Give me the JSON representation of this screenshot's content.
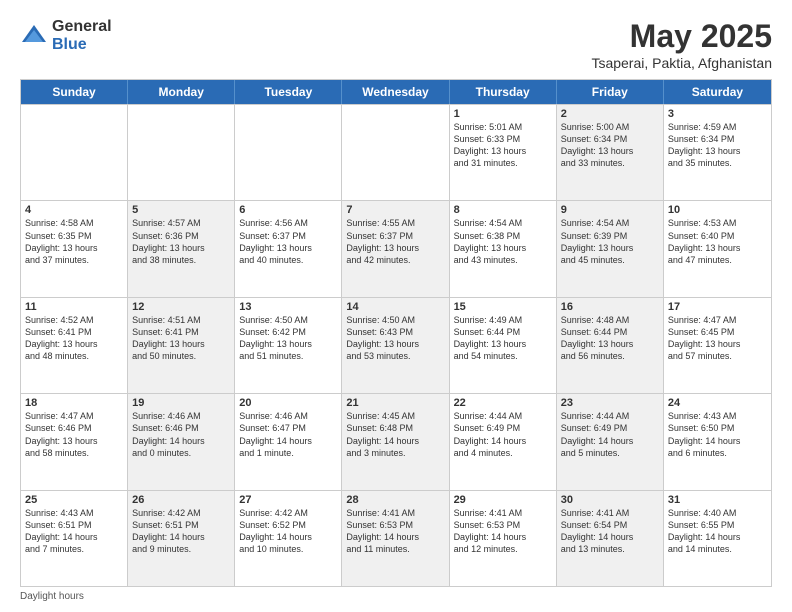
{
  "logo": {
    "general": "General",
    "blue": "Blue"
  },
  "title": "May 2025",
  "subtitle": "Tsaperai, Paktia, Afghanistan",
  "days": [
    "Sunday",
    "Monday",
    "Tuesday",
    "Wednesday",
    "Thursday",
    "Friday",
    "Saturday"
  ],
  "weeks": [
    [
      {
        "day": "",
        "text": "",
        "shaded": false
      },
      {
        "day": "",
        "text": "",
        "shaded": false
      },
      {
        "day": "",
        "text": "",
        "shaded": false
      },
      {
        "day": "",
        "text": "",
        "shaded": false
      },
      {
        "day": "1",
        "text": "Sunrise: 5:01 AM\nSunset: 6:33 PM\nDaylight: 13 hours\nand 31 minutes.",
        "shaded": false
      },
      {
        "day": "2",
        "text": "Sunrise: 5:00 AM\nSunset: 6:34 PM\nDaylight: 13 hours\nand 33 minutes.",
        "shaded": true
      },
      {
        "day": "3",
        "text": "Sunrise: 4:59 AM\nSunset: 6:34 PM\nDaylight: 13 hours\nand 35 minutes.",
        "shaded": false
      }
    ],
    [
      {
        "day": "4",
        "text": "Sunrise: 4:58 AM\nSunset: 6:35 PM\nDaylight: 13 hours\nand 37 minutes.",
        "shaded": false
      },
      {
        "day": "5",
        "text": "Sunrise: 4:57 AM\nSunset: 6:36 PM\nDaylight: 13 hours\nand 38 minutes.",
        "shaded": true
      },
      {
        "day": "6",
        "text": "Sunrise: 4:56 AM\nSunset: 6:37 PM\nDaylight: 13 hours\nand 40 minutes.",
        "shaded": false
      },
      {
        "day": "7",
        "text": "Sunrise: 4:55 AM\nSunset: 6:37 PM\nDaylight: 13 hours\nand 42 minutes.",
        "shaded": true
      },
      {
        "day": "8",
        "text": "Sunrise: 4:54 AM\nSunset: 6:38 PM\nDaylight: 13 hours\nand 43 minutes.",
        "shaded": false
      },
      {
        "day": "9",
        "text": "Sunrise: 4:54 AM\nSunset: 6:39 PM\nDaylight: 13 hours\nand 45 minutes.",
        "shaded": true
      },
      {
        "day": "10",
        "text": "Sunrise: 4:53 AM\nSunset: 6:40 PM\nDaylight: 13 hours\nand 47 minutes.",
        "shaded": false
      }
    ],
    [
      {
        "day": "11",
        "text": "Sunrise: 4:52 AM\nSunset: 6:41 PM\nDaylight: 13 hours\nand 48 minutes.",
        "shaded": false
      },
      {
        "day": "12",
        "text": "Sunrise: 4:51 AM\nSunset: 6:41 PM\nDaylight: 13 hours\nand 50 minutes.",
        "shaded": true
      },
      {
        "day": "13",
        "text": "Sunrise: 4:50 AM\nSunset: 6:42 PM\nDaylight: 13 hours\nand 51 minutes.",
        "shaded": false
      },
      {
        "day": "14",
        "text": "Sunrise: 4:50 AM\nSunset: 6:43 PM\nDaylight: 13 hours\nand 53 minutes.",
        "shaded": true
      },
      {
        "day": "15",
        "text": "Sunrise: 4:49 AM\nSunset: 6:44 PM\nDaylight: 13 hours\nand 54 minutes.",
        "shaded": false
      },
      {
        "day": "16",
        "text": "Sunrise: 4:48 AM\nSunset: 6:44 PM\nDaylight: 13 hours\nand 56 minutes.",
        "shaded": true
      },
      {
        "day": "17",
        "text": "Sunrise: 4:47 AM\nSunset: 6:45 PM\nDaylight: 13 hours\nand 57 minutes.",
        "shaded": false
      }
    ],
    [
      {
        "day": "18",
        "text": "Sunrise: 4:47 AM\nSunset: 6:46 PM\nDaylight: 13 hours\nand 58 minutes.",
        "shaded": false
      },
      {
        "day": "19",
        "text": "Sunrise: 4:46 AM\nSunset: 6:46 PM\nDaylight: 14 hours\nand 0 minutes.",
        "shaded": true
      },
      {
        "day": "20",
        "text": "Sunrise: 4:46 AM\nSunset: 6:47 PM\nDaylight: 14 hours\nand 1 minute.",
        "shaded": false
      },
      {
        "day": "21",
        "text": "Sunrise: 4:45 AM\nSunset: 6:48 PM\nDaylight: 14 hours\nand 3 minutes.",
        "shaded": true
      },
      {
        "day": "22",
        "text": "Sunrise: 4:44 AM\nSunset: 6:49 PM\nDaylight: 14 hours\nand 4 minutes.",
        "shaded": false
      },
      {
        "day": "23",
        "text": "Sunrise: 4:44 AM\nSunset: 6:49 PM\nDaylight: 14 hours\nand 5 minutes.",
        "shaded": true
      },
      {
        "day": "24",
        "text": "Sunrise: 4:43 AM\nSunset: 6:50 PM\nDaylight: 14 hours\nand 6 minutes.",
        "shaded": false
      }
    ],
    [
      {
        "day": "25",
        "text": "Sunrise: 4:43 AM\nSunset: 6:51 PM\nDaylight: 14 hours\nand 7 minutes.",
        "shaded": false
      },
      {
        "day": "26",
        "text": "Sunrise: 4:42 AM\nSunset: 6:51 PM\nDaylight: 14 hours\nand 9 minutes.",
        "shaded": true
      },
      {
        "day": "27",
        "text": "Sunrise: 4:42 AM\nSunset: 6:52 PM\nDaylight: 14 hours\nand 10 minutes.",
        "shaded": false
      },
      {
        "day": "28",
        "text": "Sunrise: 4:41 AM\nSunset: 6:53 PM\nDaylight: 14 hours\nand 11 minutes.",
        "shaded": true
      },
      {
        "day": "29",
        "text": "Sunrise: 4:41 AM\nSunset: 6:53 PM\nDaylight: 14 hours\nand 12 minutes.",
        "shaded": false
      },
      {
        "day": "30",
        "text": "Sunrise: 4:41 AM\nSunset: 6:54 PM\nDaylight: 14 hours\nand 13 minutes.",
        "shaded": true
      },
      {
        "day": "31",
        "text": "Sunrise: 4:40 AM\nSunset: 6:55 PM\nDaylight: 14 hours\nand 14 minutes.",
        "shaded": false
      }
    ]
  ],
  "footer": "Daylight hours"
}
